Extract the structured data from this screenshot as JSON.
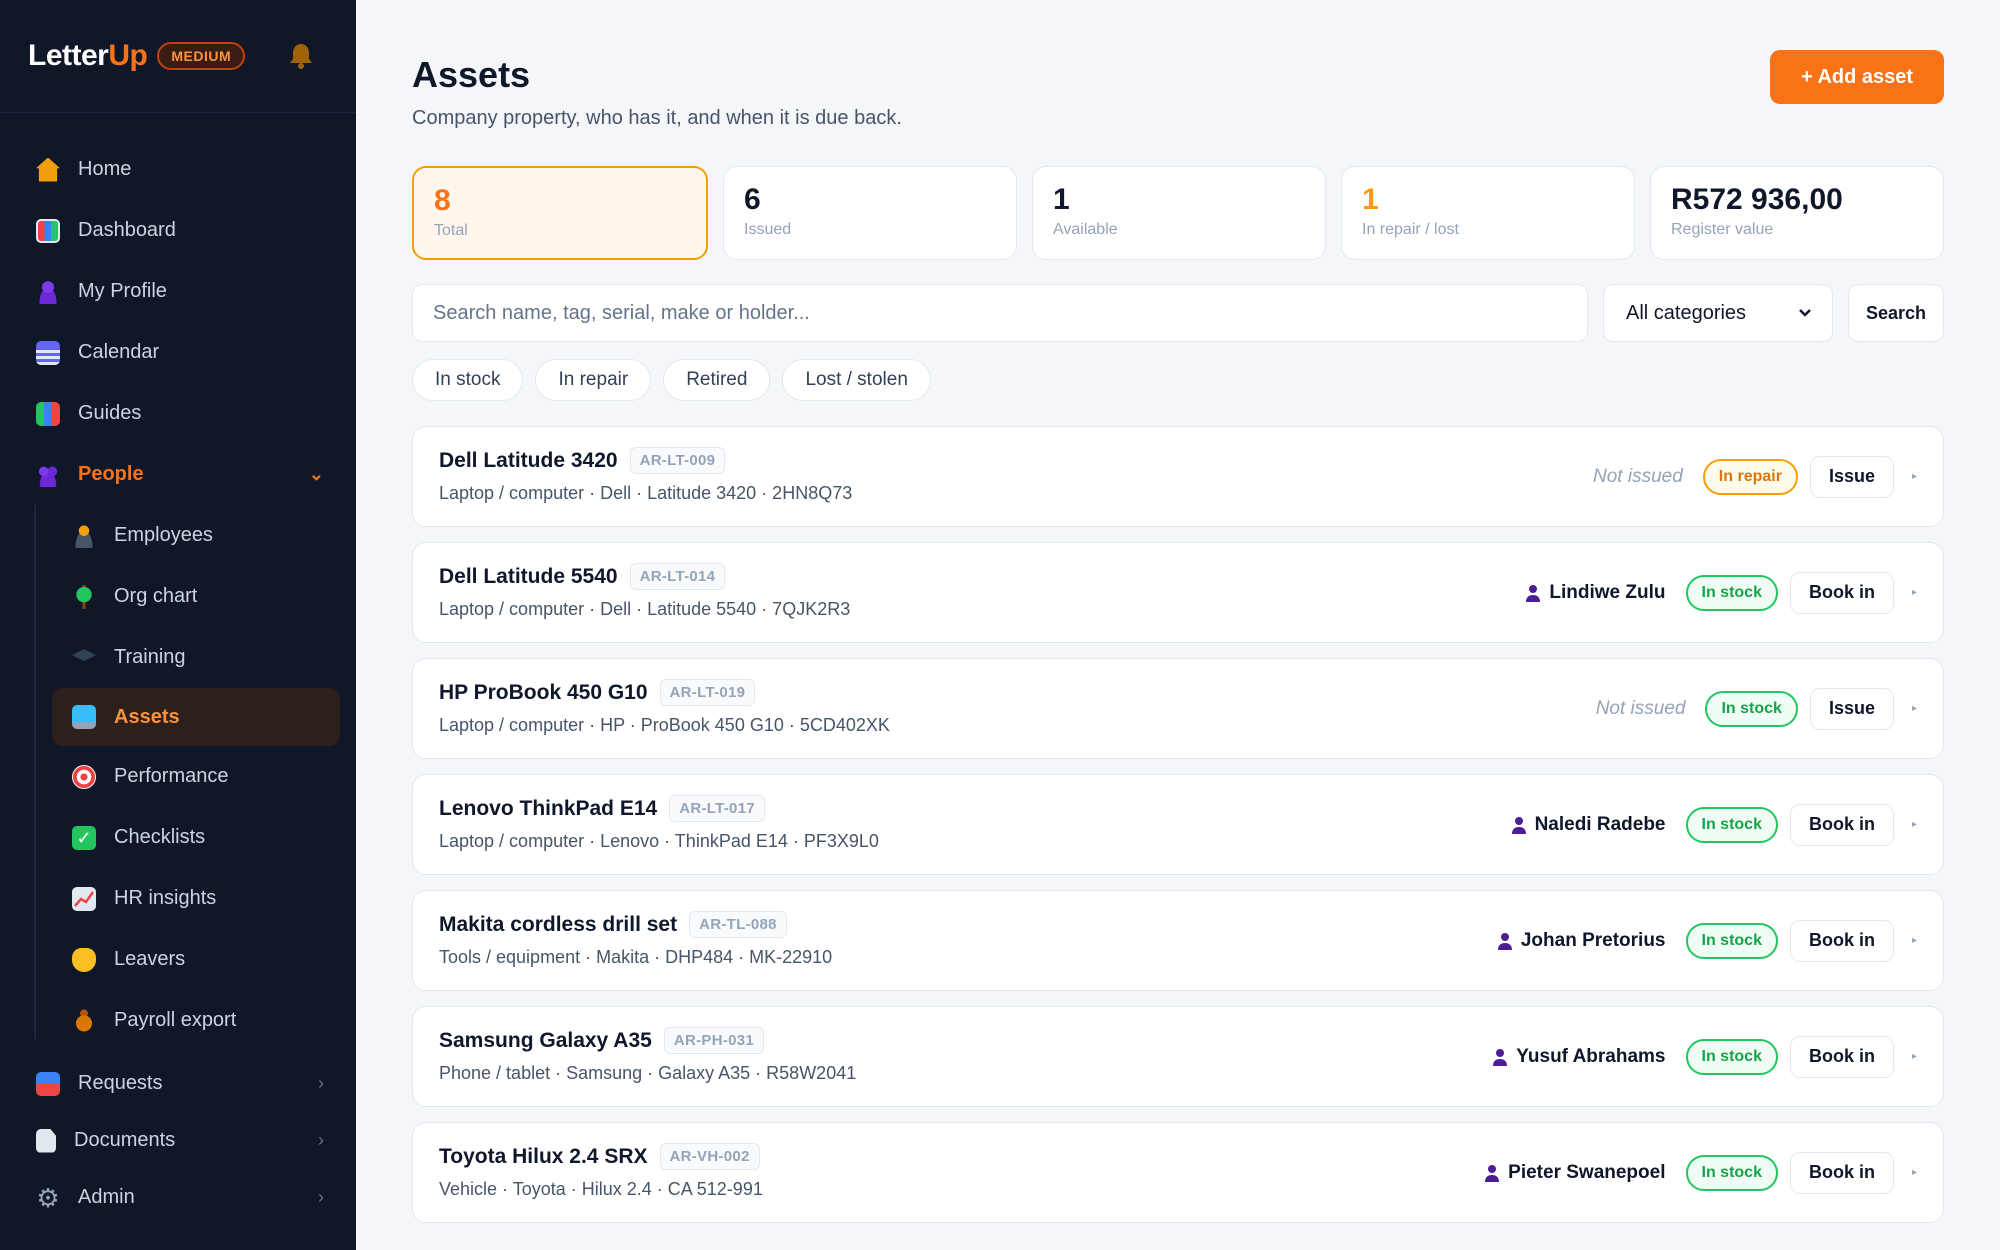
{
  "app": {
    "logo_main": "Letter",
    "logo_accent": "Up",
    "plan": "MEDIUM"
  },
  "sidebar": {
    "items": [
      {
        "label": "Home",
        "icon": "house-icon"
      },
      {
        "label": "Dashboard",
        "icon": "bar-chart-icon"
      },
      {
        "label": "My Profile",
        "icon": "person-icon"
      },
      {
        "label": "Calendar",
        "icon": "calendar-icon"
      },
      {
        "label": "Guides",
        "icon": "books-icon"
      },
      {
        "label": "People",
        "icon": "people-icon"
      }
    ],
    "people_sub": [
      {
        "label": "Employees",
        "icon": "employee-icon"
      },
      {
        "label": "Org chart",
        "icon": "tree-icon"
      },
      {
        "label": "Training",
        "icon": "graduation-cap-icon"
      },
      {
        "label": "Assets",
        "icon": "laptop-icon"
      },
      {
        "label": "Performance",
        "icon": "target-icon"
      },
      {
        "label": "Checklists",
        "icon": "checkbox-icon"
      },
      {
        "label": "HR insights",
        "icon": "chart-up-icon"
      },
      {
        "label": "Leavers",
        "icon": "waving-hand-icon"
      },
      {
        "label": "Payroll export",
        "icon": "money-bag-icon"
      }
    ],
    "bottom": [
      {
        "label": "Requests",
        "icon": "inbox-icon"
      },
      {
        "label": "Documents",
        "icon": "document-icon"
      },
      {
        "label": "Admin",
        "icon": "gear-icon"
      }
    ]
  },
  "header": {
    "title": "Assets",
    "subtitle": "Company property, who has it, and when it is due back.",
    "add_label": "+ Add asset"
  },
  "stats": [
    {
      "value": "8",
      "label": "Total"
    },
    {
      "value": "6",
      "label": "Issued"
    },
    {
      "value": "1",
      "label": "Available"
    },
    {
      "value": "1",
      "label": "In repair / lost"
    },
    {
      "value": "R572 936,00",
      "label": "Register value"
    }
  ],
  "search": {
    "placeholder": "Search name, tag, serial, make or holder...",
    "category": "All categories",
    "button": "Search"
  },
  "filters": [
    "In stock",
    "In repair",
    "Retired",
    "Lost / stolen"
  ],
  "assets": [
    {
      "name": "Dell Latitude 3420",
      "tag": "AR-LT-009",
      "meta": "Laptop / computer · Dell · Latitude 3420 · 2HN8Q73",
      "holder": "",
      "not_issued": "Not issued",
      "status": "In repair",
      "action": "Issue"
    },
    {
      "name": "Dell Latitude 5540",
      "tag": "AR-LT-014",
      "meta": "Laptop / computer · Dell · Latitude 5540 · 7QJK2R3",
      "holder": "Lindiwe Zulu",
      "not_issued": "",
      "status": "In stock",
      "action": "Book in"
    },
    {
      "name": "HP ProBook 450 G10",
      "tag": "AR-LT-019",
      "meta": "Laptop / computer · HP · ProBook 450 G10 · 5CD402XK",
      "holder": "",
      "not_issued": "Not issued",
      "status": "In stock",
      "action": "Issue"
    },
    {
      "name": "Lenovo ThinkPad E14",
      "tag": "AR-LT-017",
      "meta": "Laptop / computer · Lenovo · ThinkPad E14 · PF3X9L0",
      "holder": "Naledi Radebe",
      "not_issued": "",
      "status": "In stock",
      "action": "Book in"
    },
    {
      "name": "Makita cordless drill set",
      "tag": "AR-TL-088",
      "meta": "Tools / equipment · Makita · DHP484 · MK-22910",
      "holder": "Johan Pretorius",
      "not_issued": "",
      "status": "In stock",
      "action": "Book in"
    },
    {
      "name": "Samsung Galaxy A35",
      "tag": "AR-PH-031",
      "meta": "Phone / tablet · Samsung · Galaxy A35 · R58W2041",
      "holder": "Yusuf Abrahams",
      "not_issued": "",
      "status": "In stock",
      "action": "Book in"
    },
    {
      "name": "Toyota Hilux 2.4 SRX",
      "tag": "AR-VH-002",
      "meta": "Vehicle · Toyota · Hilux 2.4 · CA 512-991",
      "holder": "Pieter Swanepoel",
      "not_issued": "",
      "status": "In stock",
      "action": "Book in"
    }
  ],
  "colors": {
    "accent": "#f97316",
    "sidebar_bg": "#0f1729",
    "stock": "#16a34a",
    "repair": "#d97706"
  }
}
